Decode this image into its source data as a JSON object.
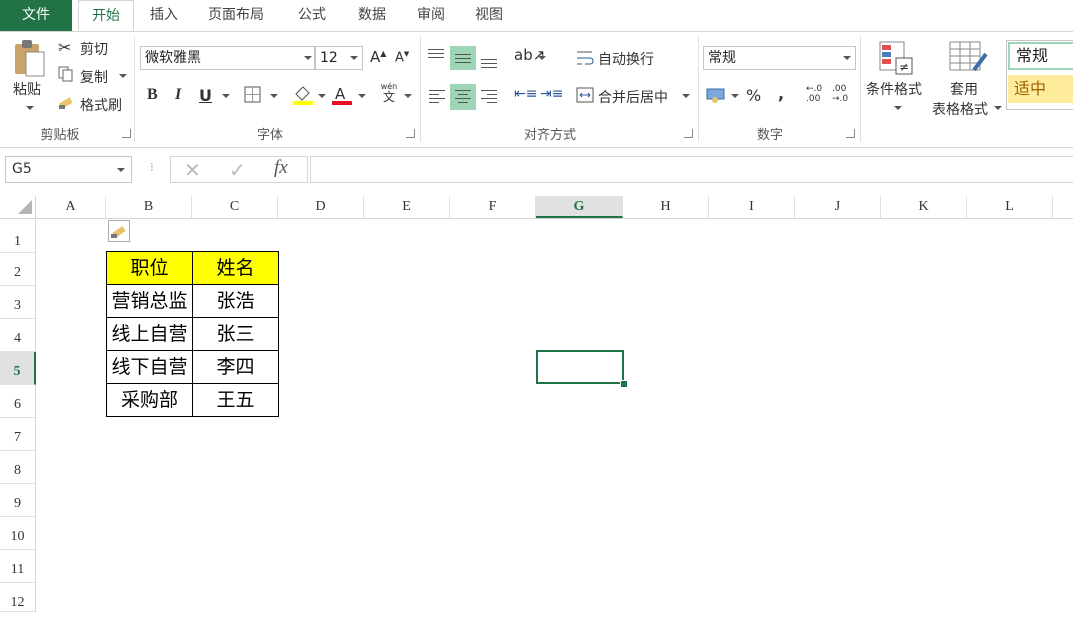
{
  "tabs": [
    "文件",
    "开始",
    "插入",
    "页面布局",
    "公式",
    "数据",
    "审阅",
    "视图"
  ],
  "clipboard": {
    "paste": "粘贴",
    "cut": "剪切",
    "copy": "复制",
    "format_painter": "格式刷",
    "group": "剪贴板"
  },
  "font": {
    "name": "微软雅黑",
    "size": "12",
    "group": "字体",
    "bold": "B",
    "italic": "I",
    "underline": "U",
    "wen_top": "wén",
    "wen_bottom": "文",
    "font_color": "#e81123",
    "fill_color": "#ffff00"
  },
  "alignment": {
    "wrap": "自动换行",
    "merge": "合并后居中",
    "group": "对齐方式"
  },
  "number": {
    "format": "常规",
    "group": "数字",
    "percent": "%",
    "comma": ",",
    "inc_decimal": "←.0 .00",
    "dec_decimal": ".00 →.0"
  },
  "styles": {
    "conditional": "条件格式",
    "table_l1": "套用",
    "table_l2": "表格格式",
    "normal": "常规",
    "neutral": "适中",
    "neutral_bg": "#ffeb9c"
  },
  "formula_bar": {
    "name_box": "G5",
    "cancel": "✕",
    "enter": "✓",
    "fx": "fx",
    "content": ""
  },
  "columns": [
    "A",
    "B",
    "C",
    "D",
    "E",
    "F",
    "G",
    "H",
    "I",
    "J",
    "K",
    "L"
  ],
  "rows": [
    "1",
    "2",
    "3",
    "4",
    "5",
    "6",
    "7",
    "8",
    "9",
    "10",
    "11",
    "12"
  ],
  "selected_cell": "G5",
  "table": {
    "headers": [
      "职位",
      "姓名"
    ],
    "rows": [
      [
        "营销总监",
        "张浩"
      ],
      [
        "线上自营",
        "张三"
      ],
      [
        "线下自营",
        "李四"
      ],
      [
        "采购部",
        "王五"
      ]
    ]
  }
}
